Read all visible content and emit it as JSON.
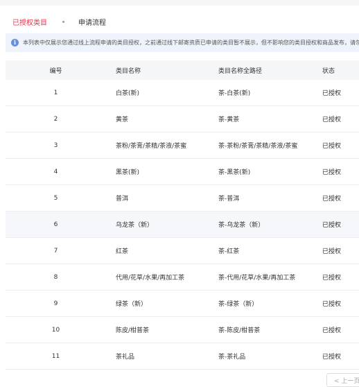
{
  "tabs": {
    "active": "已授权类目",
    "second": "申请流程"
  },
  "notice": {
    "icon": "info-icon",
    "text": "本列表中仅展示您通过线上流程申请的类目授权，之前通过线下邮寄资质已申请的类目暂不展示，但不影响您的类目授权和商品发布，请勿"
  },
  "table": {
    "headers": [
      "编号",
      "类目名称",
      "类目名称全路径",
      "状态"
    ],
    "rows": [
      {
        "id": "1",
        "name": "白茶(新)",
        "path": "茶-白茶(新)",
        "status": "已授权"
      },
      {
        "id": "2",
        "name": "黄茶",
        "path": "茶-黄茶",
        "status": "已授权"
      },
      {
        "id": "3",
        "name": "茶粉/茶膏/茶精/茶液/茶蜜",
        "path": "茶-茶粉/茶膏/茶精/茶液/茶蜜",
        "status": "已授权"
      },
      {
        "id": "4",
        "name": "黑茶(新)",
        "path": "茶-黑茶(新)",
        "status": "已授权"
      },
      {
        "id": "5",
        "name": "普洱",
        "path": "茶-普洱",
        "status": "已授权"
      },
      {
        "id": "6",
        "name": "乌龙茶（新）",
        "path": "茶-乌龙茶（新）",
        "status": "已授权"
      },
      {
        "id": "7",
        "name": "红茶",
        "path": "茶-红茶",
        "status": "已授权"
      },
      {
        "id": "8",
        "name": "代用/花草/水果/再加工茶",
        "path": "茶-代用/花草/水果/再加工茶",
        "status": "已授权"
      },
      {
        "id": "9",
        "name": "绿茶（新）",
        "path": "茶-绿茶（新）",
        "status": "已授权"
      },
      {
        "id": "10",
        "name": "陈皮/柑普茶",
        "path": "茶-陈皮/柑普茶",
        "status": "已授权"
      },
      {
        "id": "11",
        "name": "茶礼品",
        "path": "茶-茶礼品",
        "status": "已授权"
      }
    ]
  },
  "pager": {
    "prev_label": "< 上一页"
  }
}
